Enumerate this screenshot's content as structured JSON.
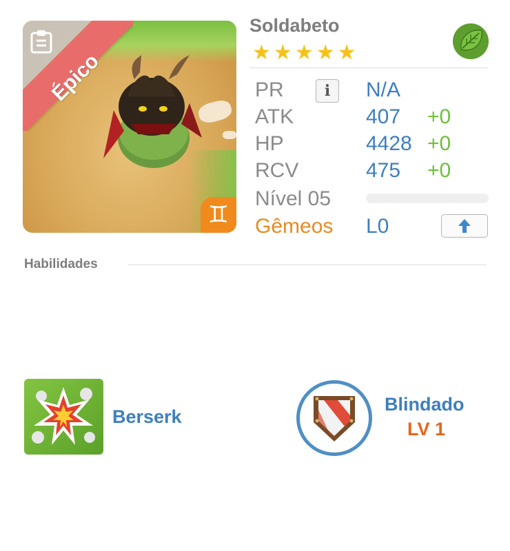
{
  "monster": {
    "name": "Soldabeto",
    "rarity": "Épico",
    "stars": 5,
    "element": "leaf-icon",
    "zodiac_symbol": "♊"
  },
  "stats": {
    "pr": {
      "label": "PR",
      "value": "N/A"
    },
    "atk": {
      "label": "ATK",
      "value": "407",
      "bonus": "+0"
    },
    "hp": {
      "label": "HP",
      "value": "4428",
      "bonus": "+0"
    },
    "rcv": {
      "label": "RCV",
      "value": "475",
      "bonus": "+0"
    },
    "level": {
      "label": "Nível 05",
      "progress": 0
    },
    "sign": {
      "label": "Gêmeos",
      "level": "L0"
    }
  },
  "skills": {
    "title": "Habilidades",
    "items": [
      {
        "name": "Berserk",
        "icon": "explosion-icon"
      },
      {
        "name": "Blindado",
        "level": "LV 1",
        "icon": "shield-icon"
      }
    ]
  },
  "colors": {
    "accent_blue": "#3d7fbd",
    "bonus_green": "#6ebf3b",
    "sign_orange": "#e98a22",
    "rarity_red": "#e86d6a",
    "star_yellow": "#f6c21a"
  }
}
